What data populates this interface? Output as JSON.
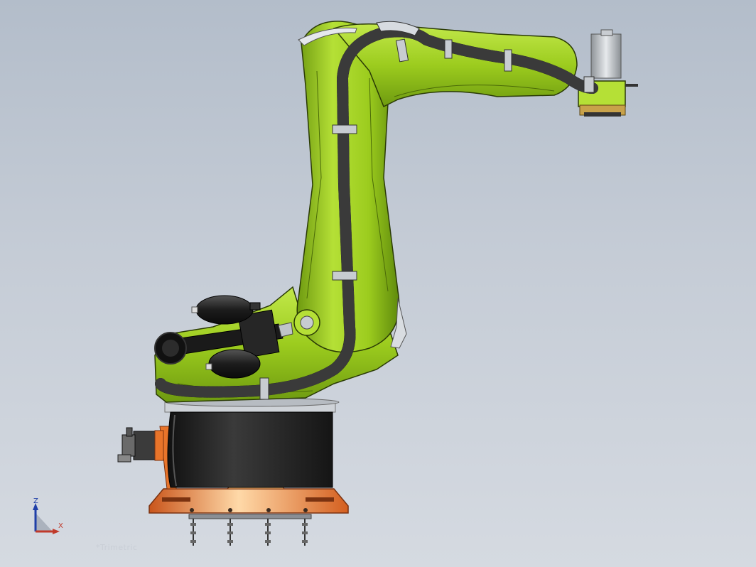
{
  "viewport": {
    "background_top": "#b3bdca",
    "background_bottom": "#d5dae1"
  },
  "model": {
    "name": "industrial-robot-arm",
    "arm_color": "#9ccc1e",
    "base_color": "#e8742a",
    "cable_color": "#1a1a1a",
    "drum_color": "#222222"
  },
  "triad": {
    "z_label": "Z",
    "x_label": "X",
    "z_color": "#1f3fa8",
    "x_color": "#c03a2b"
  },
  "view_label": "*Trimetric"
}
